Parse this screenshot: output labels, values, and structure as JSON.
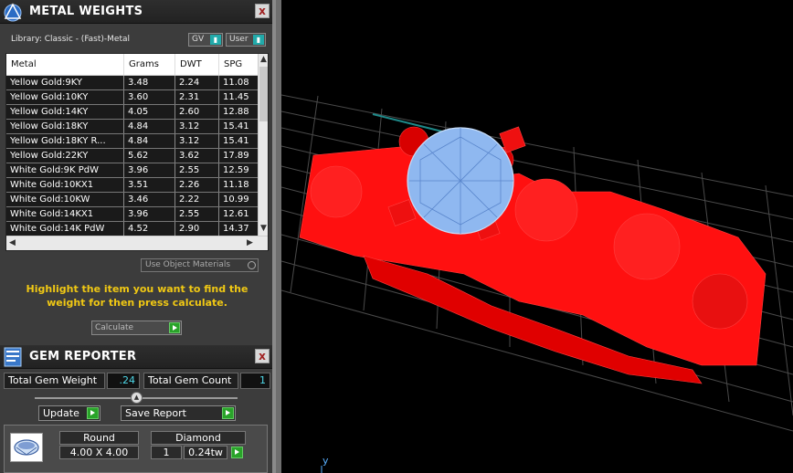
{
  "metal_panel": {
    "title": "METAL WEIGHTS",
    "close": "x",
    "library_label": "Library: Classic - (Fast)-Metal",
    "gv_select": "GV",
    "user_select": "User",
    "columns": [
      "Metal",
      "Grams",
      "DWT",
      "SPG"
    ],
    "rows": [
      [
        "Yellow Gold:9KY",
        "3.48",
        "2.24",
        "11.08"
      ],
      [
        "Yellow Gold:10KY",
        "3.60",
        "2.31",
        "11.45"
      ],
      [
        "Yellow Gold:14KY",
        "4.05",
        "2.60",
        "12.88"
      ],
      [
        "Yellow Gold:18KY",
        "4.84",
        "3.12",
        "15.41"
      ],
      [
        "Yellow Gold:18KY R...",
        "4.84",
        "3.12",
        "15.41"
      ],
      [
        "Yellow Gold:22KY",
        "5.62",
        "3.62",
        "17.89"
      ],
      [
        "White Gold:9K PdW",
        "3.96",
        "2.55",
        "12.59"
      ],
      [
        "White Gold:10KX1",
        "3.51",
        "2.26",
        "11.18"
      ],
      [
        "White Gold:10KW",
        "3.46",
        "2.22",
        "10.99"
      ],
      [
        "White Gold:14KX1",
        "3.96",
        "2.55",
        "12.61"
      ],
      [
        "White Gold:14K PdW",
        "4.52",
        "2.90",
        "14.37"
      ]
    ],
    "use_object_materials": "Use Object Materials",
    "hint": "Highlight the item you want to find the weight for then press calculate.",
    "calculate": "Calculate"
  },
  "gem_panel": {
    "title": "GEM REPORTER",
    "close": "x",
    "total_weight_label": "Total Gem Weight",
    "total_weight_value": ".24",
    "total_count_label": "Total Gem Count",
    "total_count_value": "1",
    "update": "Update",
    "save_report": "Save Report",
    "gem_row": {
      "shape": "Round",
      "size": "4.00 X 4.00",
      "type": "Diamond",
      "count": "1",
      "weight": "0.24tw"
    }
  },
  "viewport": {
    "axis_label": "y",
    "colors": {
      "metal": "#ff0000",
      "gem": "#8fb8f0",
      "grid": "#5a5a5a",
      "background": "#000000"
    }
  }
}
